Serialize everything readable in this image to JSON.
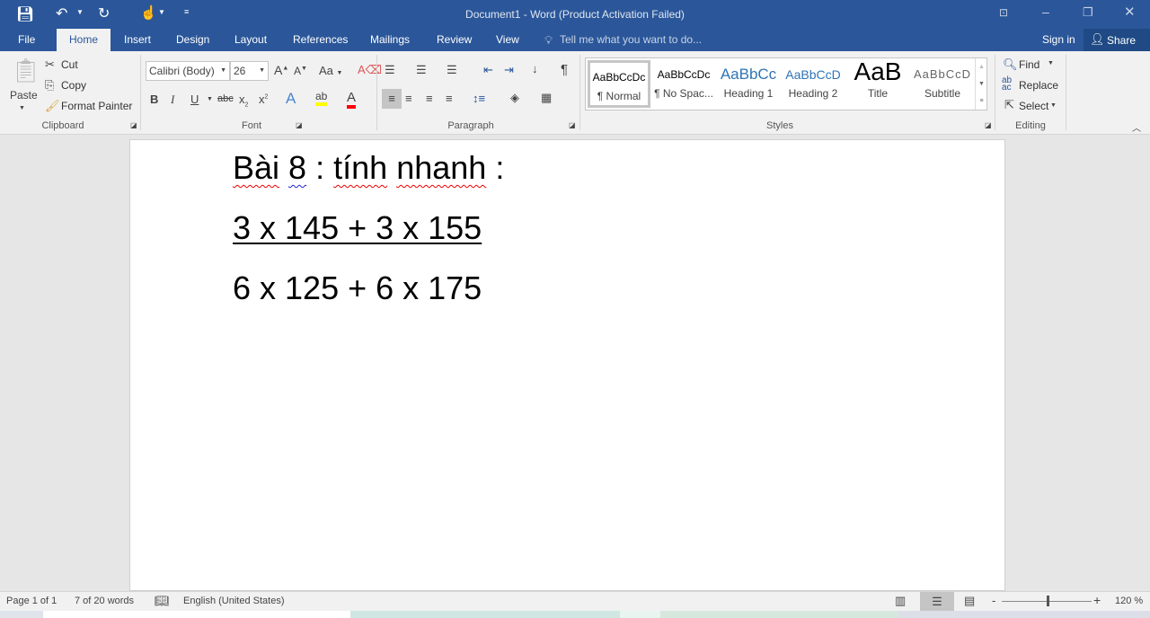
{
  "titlebar": {
    "title": "Document1 - Word (Product Activation Failed)"
  },
  "tabs": [
    {
      "label": "File"
    },
    {
      "label": "Home"
    },
    {
      "label": "Insert"
    },
    {
      "label": "Design"
    },
    {
      "label": "Layout"
    },
    {
      "label": "References"
    },
    {
      "label": "Mailings"
    },
    {
      "label": "Review"
    },
    {
      "label": "View"
    }
  ],
  "tell_me": "Tell me what you want to do...",
  "sign_in": "Sign in",
  "share": "Share",
  "clipboard": {
    "paste": "Paste",
    "cut": "Cut",
    "copy": "Copy",
    "format_painter": "Format Painter",
    "label": "Clipboard"
  },
  "font": {
    "name": "Calibri (Body)",
    "size": "26",
    "label": "Font",
    "highlight_color": "#ffff00",
    "font_color": "#ff0000"
  },
  "paragraph": {
    "label": "Paragraph"
  },
  "styles": {
    "label": "Styles",
    "items": [
      {
        "preview": "AaBbCcDc",
        "name": "¶ Normal"
      },
      {
        "preview": "AaBbCcDc",
        "name": "¶ No Spac..."
      },
      {
        "preview": "AaBbCc",
        "name": "Heading 1"
      },
      {
        "preview": "AaBbCcD",
        "name": "Heading 2"
      },
      {
        "preview": "AaB",
        "name": "Title"
      },
      {
        "preview": "AaBbCcD",
        "name": "Subtitle"
      }
    ]
  },
  "editing": {
    "find": "Find",
    "replace": "Replace",
    "select": "Select",
    "label": "Editing"
  },
  "document": {
    "line1": {
      "w1": "Bài",
      "w2": "8",
      "w3": ":",
      "w4": "tính",
      "w5": "nhanh",
      "w6": ":"
    },
    "line2": "3 x 145 + 3 x 155",
    "line3": "6 x 125 + 6 x 175"
  },
  "status": {
    "page": "Page 1 of 1",
    "words": "7 of 20 words",
    "language": "English (United States)",
    "zoom": "120 %"
  },
  "colors": {
    "accent": "#2b579a"
  }
}
